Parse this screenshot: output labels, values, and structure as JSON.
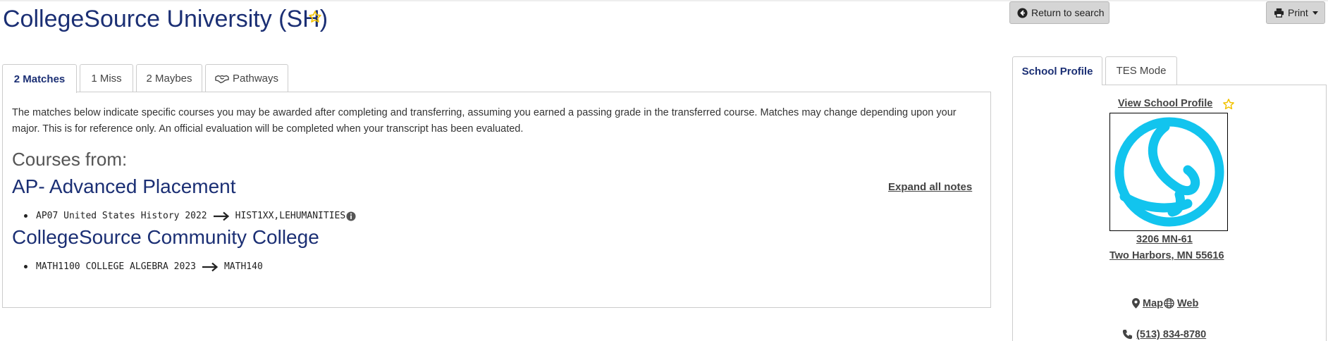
{
  "header": {
    "title": "CollegeSource University (SH)",
    "return_label": "Return to search",
    "print_label": "Print"
  },
  "tabs": [
    {
      "label": "2 Matches",
      "active": true
    },
    {
      "label": "1 Miss",
      "active": false
    },
    {
      "label": "2 Maybes",
      "active": false
    },
    {
      "label": "Pathways",
      "active": false,
      "icon": "handshake-icon"
    }
  ],
  "panel": {
    "description": "The matches below indicate specific courses you may be awarded after completing and transferring, assuming you earned a passing grade in the transferred course. Matches may change depending upon your major. This is for reference only. An official evaluation will be completed when your transcript has been evaluated.",
    "courses_from": "Courses from:",
    "expand_all_notes": "Expand all notes",
    "schools": [
      {
        "name": "AP- Advanced Placement",
        "matches": [
          {
            "source": "AP07 United States History 2022",
            "target": "HIST1XX,LEHUMANITIES",
            "has_info": true
          }
        ]
      },
      {
        "name": "CollegeSource Community College",
        "matches": [
          {
            "source": "MATH1100 COLLEGE ALGEBRA 2023",
            "target": "MATH140",
            "has_info": false
          }
        ]
      }
    ]
  },
  "sidebar": {
    "tabs": [
      {
        "label": "School Profile",
        "active": true
      },
      {
        "label": "TES Mode",
        "active": false
      }
    ],
    "view_profile": "View School Profile",
    "address_line1": "3206 MN-61",
    "address_line2": "Two Harbors, MN 55616",
    "map_label": "Map",
    "web_label": "Web",
    "phone": "(513) 834-8780"
  },
  "colors": {
    "title_blue": "#1b2f74",
    "logo_cyan": "#12c4ee",
    "star_yellow": "#f2c200"
  }
}
